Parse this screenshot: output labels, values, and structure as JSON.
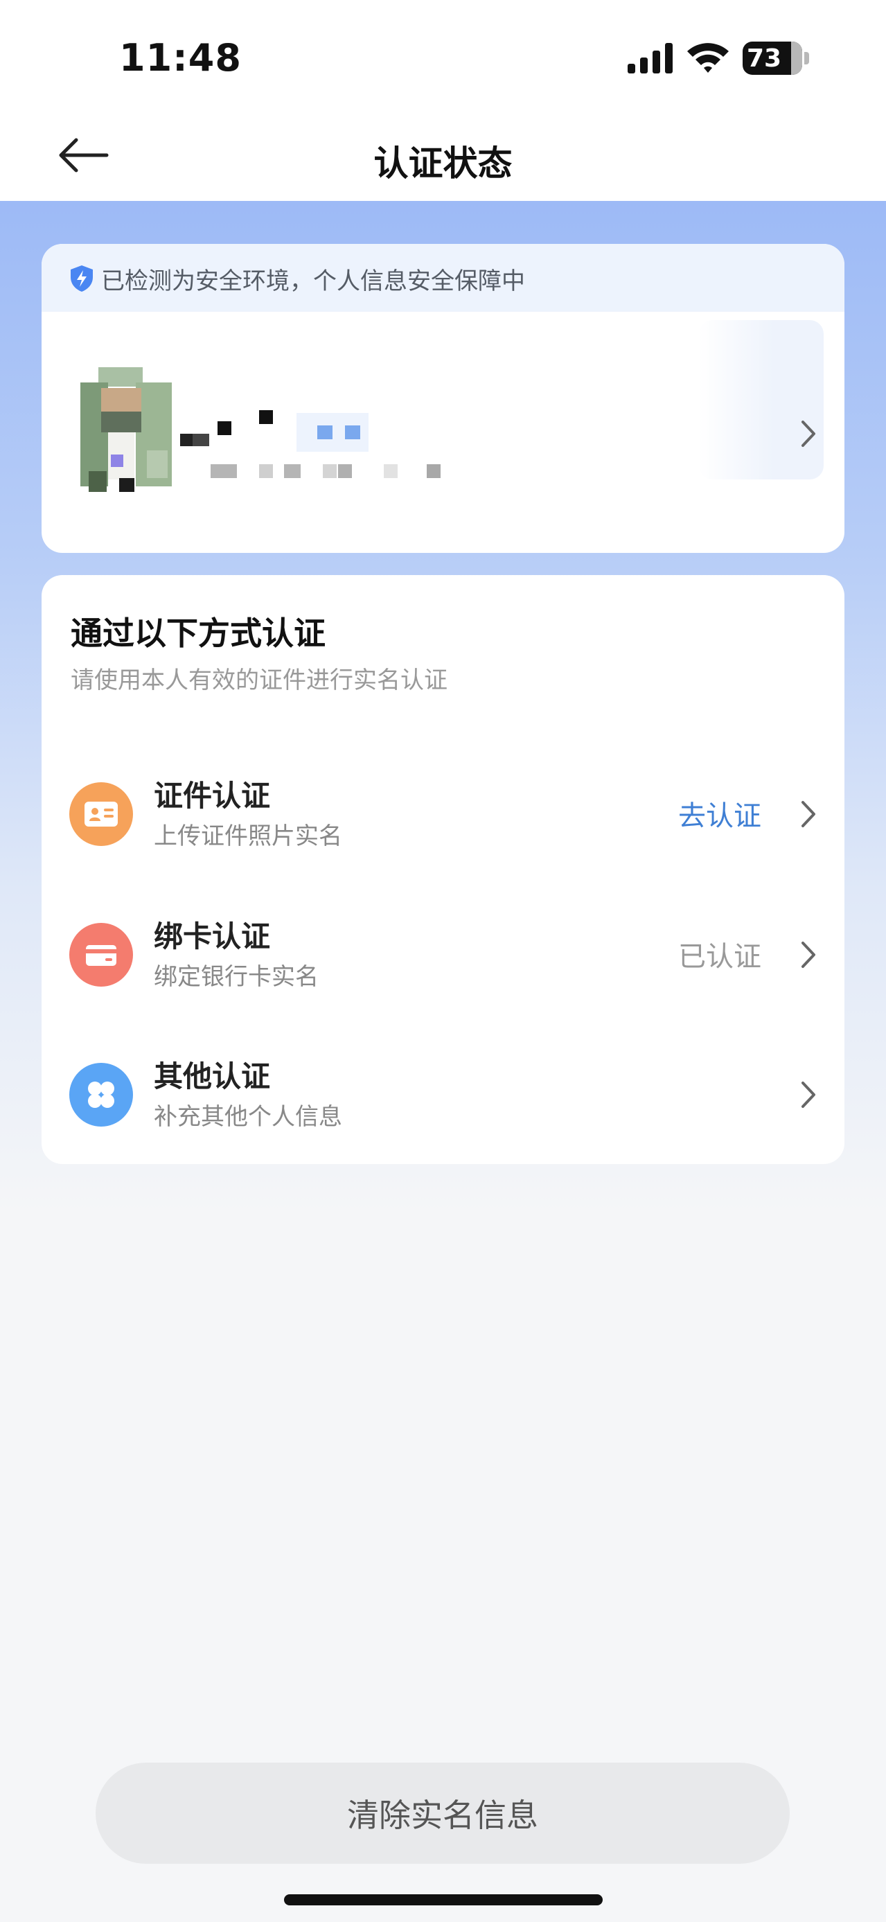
{
  "status_bar": {
    "time": "11:48",
    "battery": "73",
    "battery_level_percent": 73
  },
  "nav": {
    "title": "认证状态",
    "back_icon": "arrow-left-icon"
  },
  "profile": {
    "safety_notice": "已检测为安全环境，个人信息安全保障中",
    "safety_icon": "shield-bolt-icon",
    "avatar": "pixelated-avatar",
    "name": "pixelated (redacted)"
  },
  "methods": {
    "title": "通过以下方式认证",
    "subtitle": "请使用本人有效的证件进行实名认证",
    "items": [
      {
        "label": "证件认证",
        "desc": "上传证件照片实名",
        "status": "去认证",
        "status_color": "#3f7fd4",
        "icon": "id-card-icon",
        "icon_color": "#f6a25a"
      },
      {
        "label": "绑卡认证",
        "desc": "绑定银行卡实名",
        "status": "已认证",
        "status_color": "#999999",
        "icon": "bank-card-icon",
        "icon_color": "#f47c6e"
      },
      {
        "label": "其他认证",
        "desc": "补充其他个人信息",
        "status": "",
        "status_color": "#999999",
        "icon": "clover-icon",
        "icon_color": "#5aa5f5"
      }
    ]
  },
  "footer": {
    "clear_button": "清除实名信息"
  },
  "colors": {
    "accent_blue": "#3f7fd4",
    "hero_gradient_top": "#9dbaf6"
  }
}
